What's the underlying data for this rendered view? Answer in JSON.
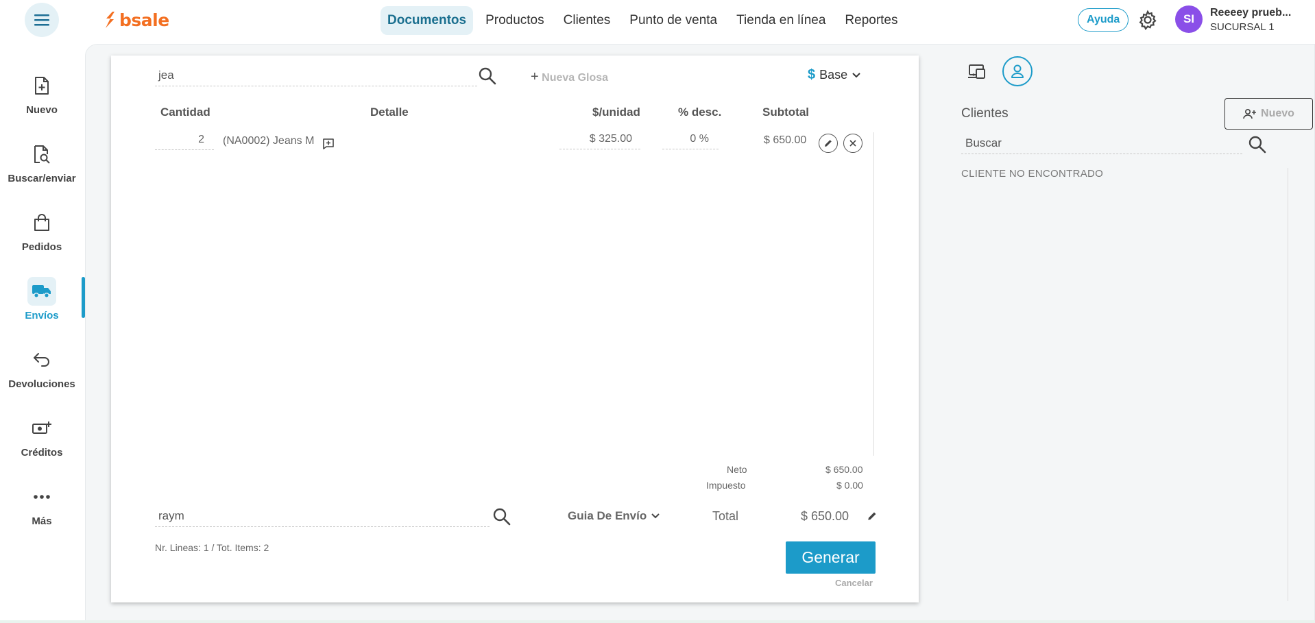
{
  "brand": {
    "name": "bsale",
    "color": "#f36f21"
  },
  "accent": "#1c9bc9",
  "topnav": [
    {
      "label": "Documentos",
      "active": true
    },
    {
      "label": "Productos"
    },
    {
      "label": "Clientes"
    },
    {
      "label": "Punto de venta"
    },
    {
      "label": "Tienda en línea"
    },
    {
      "label": "Reportes"
    }
  ],
  "header": {
    "help_label": "Ayuda",
    "avatar_initials": "SI",
    "user_name": "Reeeey prueb...",
    "branch": "SUCURSAL 1"
  },
  "sidebar": [
    {
      "label": "Nuevo",
      "icon": "file-plus-icon"
    },
    {
      "label": "Buscar/enviar",
      "icon": "file-search-icon"
    },
    {
      "label": "Pedidos",
      "icon": "bag-icon"
    },
    {
      "label": "Envíos",
      "icon": "truck-icon",
      "active": true
    },
    {
      "label": "Devoluciones",
      "icon": "undo-arrow-icon"
    },
    {
      "label": "Créditos",
      "icon": "money-plus-icon"
    },
    {
      "label": "Más",
      "icon": "more-dots-icon"
    }
  ],
  "document": {
    "product_search": "jea",
    "glosa_label": "Nueva Glosa",
    "price_list": {
      "symbol": "$",
      "label": "Base"
    },
    "columns": {
      "qty": "Cantidad",
      "detail": "Detalle",
      "unit": "$/unidad",
      "discount": "% desc.",
      "subtotal": "Subtotal"
    },
    "rows": [
      {
        "qty": "2",
        "detail": "(NA0002) Jeans M",
        "unit_price": "$ 325.00",
        "discount": "0 %",
        "subtotal": "$ 650.00"
      }
    ],
    "totals": {
      "neto_label": "Neto",
      "neto": "$ 650.00",
      "tax_label": "Impuesto",
      "tax": "$ 0.00",
      "total_label": "Total",
      "total": "$ 650.00"
    },
    "seller_search": "raym",
    "doc_type": "Guia De Envío",
    "counts": "Nr. Lineas: 1 / Tot. Items: 2",
    "generate_label": "Generar",
    "cancel_label": "Cancelar"
  },
  "clients": {
    "title": "Clientes",
    "new_label": "Nuevo",
    "search_placeholder": "Buscar",
    "status": "CLIENTE NO ENCONTRADO"
  }
}
